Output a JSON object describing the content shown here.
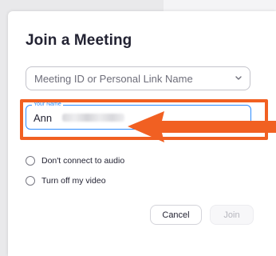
{
  "dialog": {
    "title": "Join a Meeting",
    "meeting_id": {
      "placeholder": "Meeting ID or Personal Link Name",
      "icon": "chevron-down-icon"
    },
    "name": {
      "label": "Your Name",
      "value_visible": "Ann"
    },
    "options": [
      {
        "label": "Don't connect to audio",
        "checked": false
      },
      {
        "label": "Turn off my video",
        "checked": false
      }
    ],
    "buttons": {
      "cancel": "Cancel",
      "join": "Join"
    }
  },
  "annotation": {
    "highlight_color": "#f16022",
    "accent_color": "#2d8cff"
  }
}
